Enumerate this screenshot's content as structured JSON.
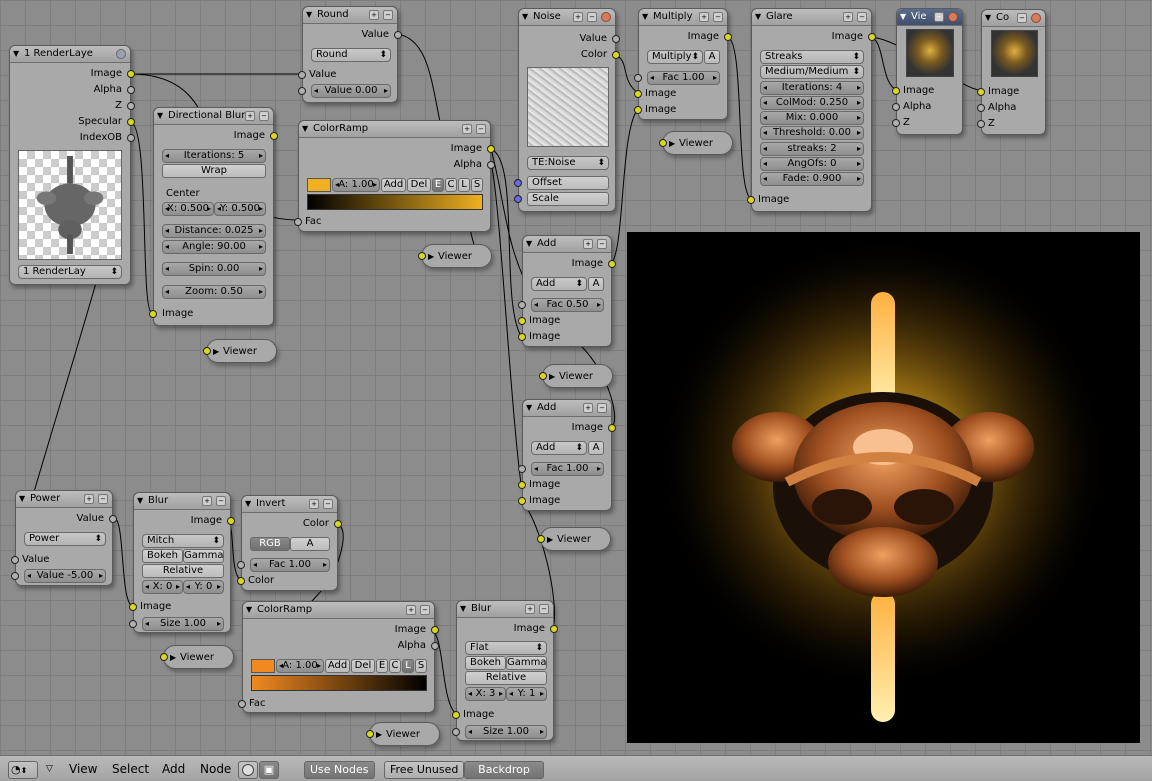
{
  "app": {
    "name": "Blender Node Editor"
  },
  "bottombar": {
    "menus": [
      "View",
      "Select",
      "Add",
      "Node"
    ],
    "use_nodes": "Use Nodes",
    "free_unused": "Free Unused",
    "backdrop": "Backdrop"
  },
  "nodes": {
    "render_layer": {
      "title": "1 RenderLaye",
      "outputs": [
        "Image",
        "Alpha",
        "Z",
        "Specular",
        "IndexOB"
      ],
      "layer_select": "1 RenderLay"
    },
    "directional_blur": {
      "title": "Directional Blur",
      "output": "Image",
      "iterations": "Iterations: 5",
      "wrap": "Wrap",
      "center_label": "Center",
      "x": "X: 0.500",
      "y": "Y: 0.500",
      "distance": "Distance: 0.025",
      "angle": "Angle: 90.00",
      "spin": "Spin: 0.00",
      "zoom": "Zoom: 0.50",
      "input": "Image"
    },
    "round": {
      "title": "Round",
      "output": "Value",
      "mode": "Round",
      "input": "Value",
      "value": "Value 0.00"
    },
    "colorramp1": {
      "title": "ColorRamp",
      "outputs": [
        "Image",
        "Alpha"
      ],
      "alpha": "A: 1.00",
      "add": "Add",
      "del": "Del",
      "e": "E",
      "c": "C",
      "l": "L",
      "s": "S",
      "input": "Fac",
      "swatch": "#f0b020"
    },
    "noise": {
      "title": "Noise",
      "outputs": [
        "Value",
        "Color"
      ],
      "texture": "TE:Noise",
      "inputs": [
        "Offset",
        "Scale"
      ]
    },
    "multiply": {
      "title": "Multiply",
      "output": "Image",
      "mode": "Multiply",
      "a": "A",
      "fac": "Fac 1.00",
      "inputs": [
        "Image",
        "Image"
      ]
    },
    "glare": {
      "title": "Glare",
      "output": "Image",
      "type": "Streaks",
      "quality": "Medium/Medium",
      "iterations": "Iterations: 4",
      "colmod": "ColMod: 0.250",
      "mix": "Mix: 0.000",
      "threshold": "Threshold: 0.00",
      "streaks": "streaks: 2",
      "angofs": "AngOfs: 0",
      "fade": "Fade: 0.900",
      "input": "Image"
    },
    "viewer_node": {
      "title": "Vie",
      "inputs": [
        "Image",
        "Alpha",
        "Z"
      ]
    },
    "composite": {
      "title": "Co",
      "inputs": [
        "Image",
        "Alpha",
        "Z"
      ]
    },
    "add1": {
      "title": "Add",
      "output": "Image",
      "mode": "Add",
      "a": "A",
      "fac": "Fac 0.50",
      "inputs": [
        "Image",
        "Image"
      ]
    },
    "add2": {
      "title": "Add",
      "output": "Image",
      "mode": "Add",
      "a": "A",
      "fac": "Fac 1.00",
      "inputs": [
        "Image",
        "Image"
      ]
    },
    "power": {
      "title": "Power",
      "output": "Value",
      "mode": "Power",
      "input": "Value",
      "value": "Value -5.00"
    },
    "blur1": {
      "title": "Blur",
      "output": "Image",
      "filter": "Mitch",
      "bokeh": "Bokeh",
      "gamma": "Gamma",
      "relative": "Relative",
      "x": "X: 0",
      "y": "Y: 0",
      "input": "Image",
      "size": "Size 1.00"
    },
    "invert": {
      "title": "Invert",
      "output": "Color",
      "rgb": "RGB",
      "a": "A",
      "fac": "Fac 1.00",
      "input": "Color"
    },
    "colorramp2": {
      "title": "ColorRamp",
      "outputs": [
        "Image",
        "Alpha"
      ],
      "alpha": "A: 1.00",
      "add": "Add",
      "del": "Del",
      "e": "E",
      "c": "C",
      "l": "L",
      "s": "S",
      "input": "Fac",
      "swatch": "#f08a20"
    },
    "blur2": {
      "title": "Blur",
      "output": "Image",
      "filter": "Flat",
      "bokeh": "Bokeh",
      "gamma": "Gamma",
      "relative": "Relative",
      "x": "X: 3",
      "y": "Y: 1",
      "input": "Image",
      "size": "Size 1.00"
    }
  },
  "viewer_label": "Viewer",
  "colors": {
    "socket": "#d8d820",
    "grid_bg": "#8c8c8c",
    "node_bg": "#a9a9a9",
    "glow": "#e8b020"
  }
}
